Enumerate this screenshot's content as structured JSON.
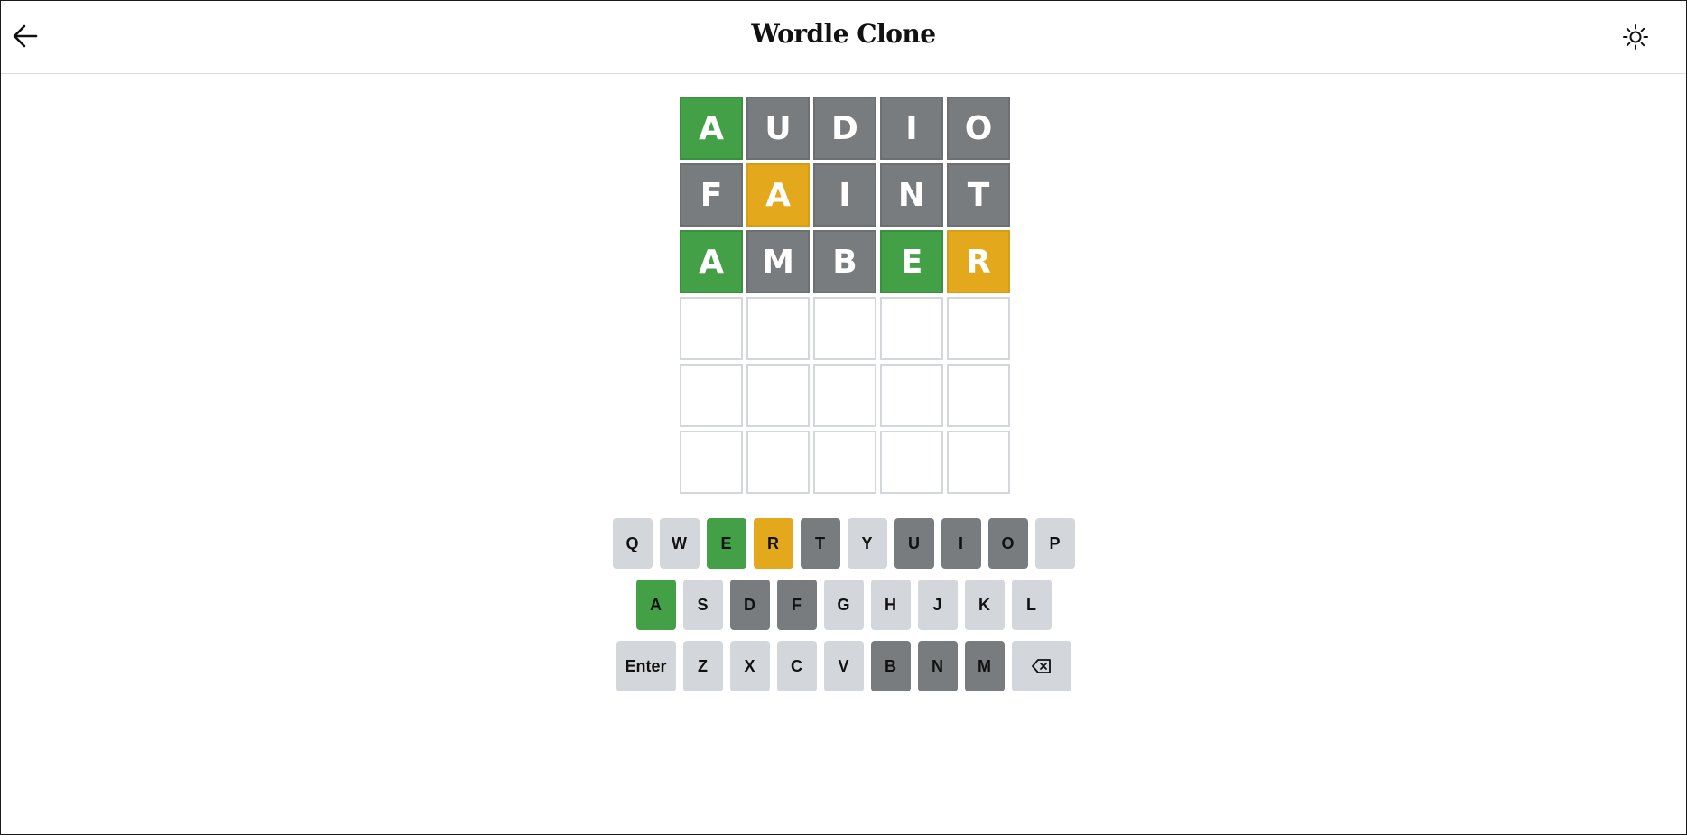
{
  "app": {
    "title": "Wordle Clone"
  },
  "header": {
    "back_icon": "arrow-left-icon",
    "theme_icon": "sun-icon"
  },
  "colors": {
    "correct": "#43a047",
    "present": "#e4a81d",
    "absent": "#787c7e",
    "unused_key": "#d3d6da",
    "empty_tile_border": "#d3d6da"
  },
  "board": {
    "rows": [
      [
        {
          "letter": "A",
          "state": "correct"
        },
        {
          "letter": "U",
          "state": "absent"
        },
        {
          "letter": "D",
          "state": "absent"
        },
        {
          "letter": "I",
          "state": "absent"
        },
        {
          "letter": "O",
          "state": "absent"
        }
      ],
      [
        {
          "letter": "F",
          "state": "absent"
        },
        {
          "letter": "A",
          "state": "present"
        },
        {
          "letter": "I",
          "state": "absent"
        },
        {
          "letter": "N",
          "state": "absent"
        },
        {
          "letter": "T",
          "state": "absent"
        }
      ],
      [
        {
          "letter": "A",
          "state": "correct"
        },
        {
          "letter": "M",
          "state": "absent"
        },
        {
          "letter": "B",
          "state": "absent"
        },
        {
          "letter": "E",
          "state": "correct"
        },
        {
          "letter": "R",
          "state": "present"
        }
      ],
      [
        {
          "letter": "",
          "state": "empty"
        },
        {
          "letter": "",
          "state": "empty"
        },
        {
          "letter": "",
          "state": "empty"
        },
        {
          "letter": "",
          "state": "empty"
        },
        {
          "letter": "",
          "state": "empty"
        }
      ],
      [
        {
          "letter": "",
          "state": "empty"
        },
        {
          "letter": "",
          "state": "empty"
        },
        {
          "letter": "",
          "state": "empty"
        },
        {
          "letter": "",
          "state": "empty"
        },
        {
          "letter": "",
          "state": "empty"
        }
      ],
      [
        {
          "letter": "",
          "state": "empty"
        },
        {
          "letter": "",
          "state": "empty"
        },
        {
          "letter": "",
          "state": "empty"
        },
        {
          "letter": "",
          "state": "empty"
        },
        {
          "letter": "",
          "state": "empty"
        }
      ]
    ]
  },
  "keyboard": {
    "rows": [
      [
        {
          "label": "Q",
          "state": "unused"
        },
        {
          "label": "W",
          "state": "unused"
        },
        {
          "label": "E",
          "state": "correct"
        },
        {
          "label": "R",
          "state": "present"
        },
        {
          "label": "T",
          "state": "absent"
        },
        {
          "label": "Y",
          "state": "unused"
        },
        {
          "label": "U",
          "state": "absent"
        },
        {
          "label": "I",
          "state": "absent"
        },
        {
          "label": "O",
          "state": "absent"
        },
        {
          "label": "P",
          "state": "unused"
        }
      ],
      [
        {
          "label": "A",
          "state": "correct"
        },
        {
          "label": "S",
          "state": "unused"
        },
        {
          "label": "D",
          "state": "absent"
        },
        {
          "label": "F",
          "state": "absent"
        },
        {
          "label": "G",
          "state": "unused"
        },
        {
          "label": "H",
          "state": "unused"
        },
        {
          "label": "J",
          "state": "unused"
        },
        {
          "label": "K",
          "state": "unused"
        },
        {
          "label": "L",
          "state": "unused"
        }
      ],
      [
        {
          "label": "Enter",
          "state": "unused",
          "wide": true
        },
        {
          "label": "Z",
          "state": "unused"
        },
        {
          "label": "X",
          "state": "unused"
        },
        {
          "label": "C",
          "state": "unused"
        },
        {
          "label": "V",
          "state": "unused"
        },
        {
          "label": "B",
          "state": "absent"
        },
        {
          "label": "N",
          "state": "absent"
        },
        {
          "label": "M",
          "state": "absent"
        },
        {
          "label": "",
          "icon": "backspace-icon",
          "state": "unused",
          "wide": true
        }
      ]
    ]
  }
}
